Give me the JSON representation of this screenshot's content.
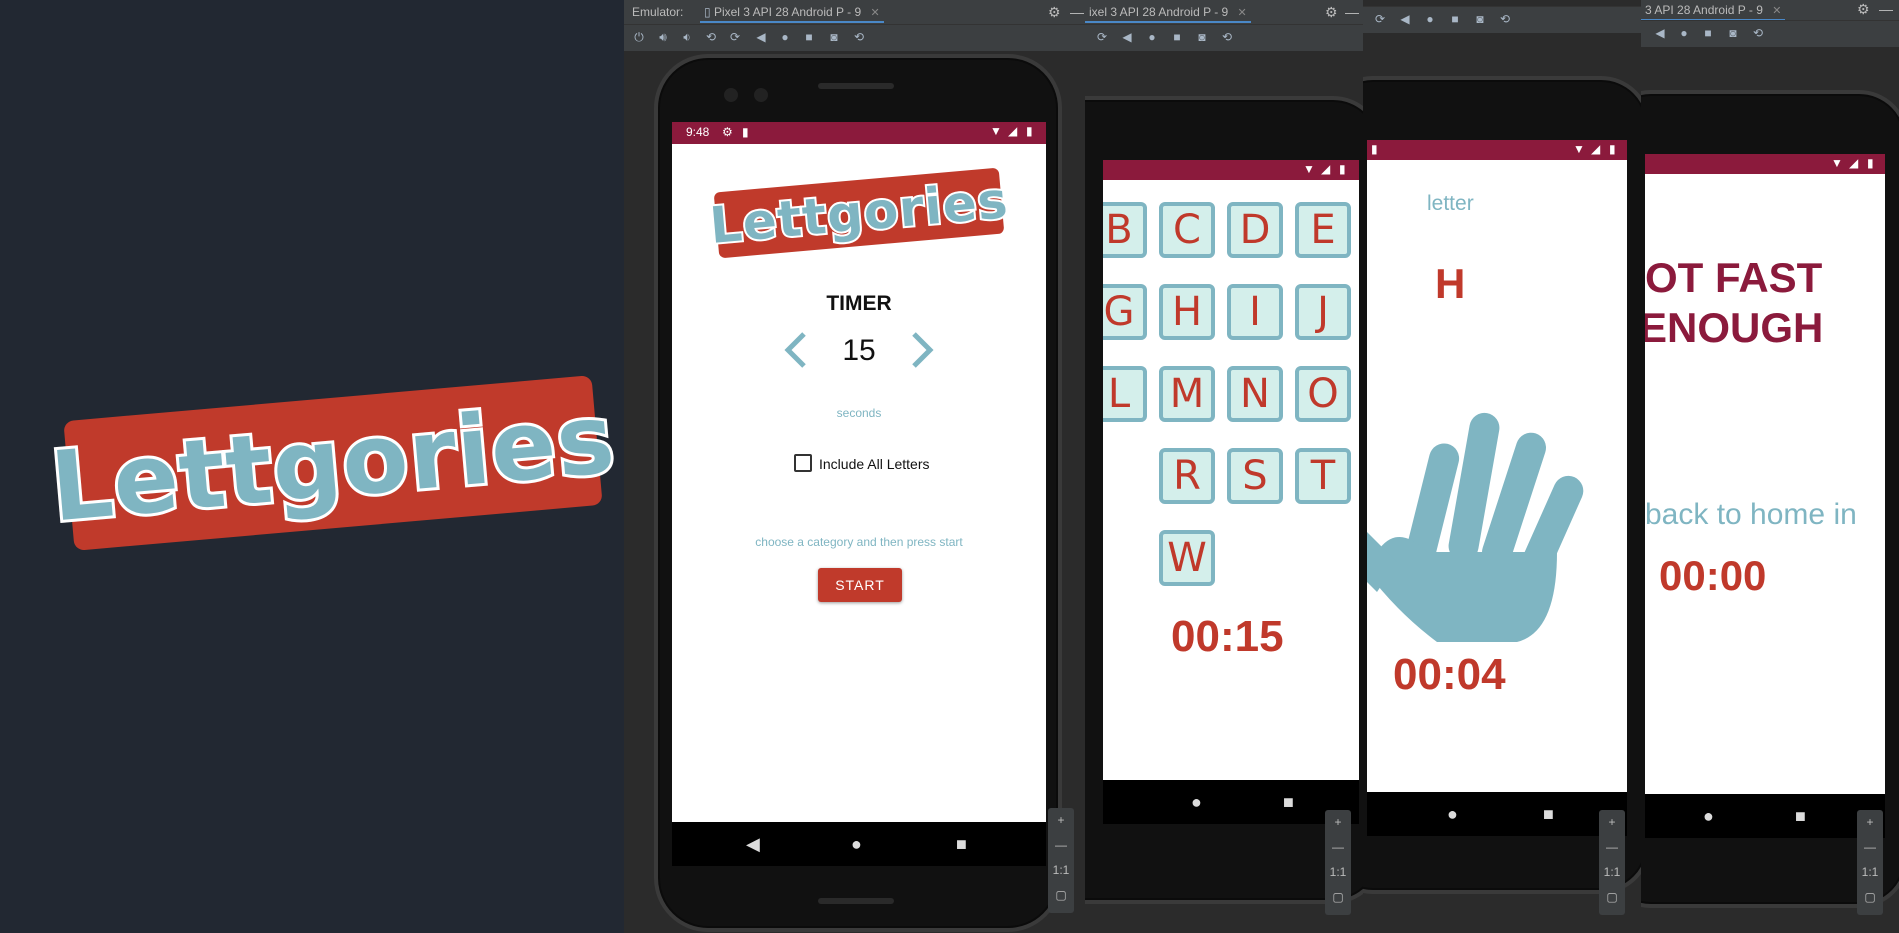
{
  "logo_text": "Lettgories",
  "colors": {
    "background": "#222832",
    "accent_red": "#c03a2b",
    "teal": "#7fb5c2",
    "status_bar": "#8b1a3c",
    "tile_fill": "#d4efeb"
  },
  "panel1": {
    "emulator_label": "Emulator:",
    "tab_label": "Pixel 3 API 28 Android P - 9",
    "status_time": "9:48",
    "logo_text": "Lettgories",
    "timer_title": "TIMER",
    "timer_value": "15",
    "timer_unit": "seconds",
    "checkbox_label": "Include All Letters",
    "hint": "choose a category and then press start",
    "start_label": "START"
  },
  "panel2": {
    "tab_label": "ixel 3 API 28 Android P - 9",
    "letters": [
      "B",
      "C",
      "D",
      "E",
      "G",
      "H",
      "I",
      "J",
      "L",
      "M",
      "N",
      "O",
      "R",
      "S",
      "T",
      "W"
    ],
    "timer": "00:15"
  },
  "panel3": {
    "label": "letter",
    "letter": "H",
    "timer": "00:04"
  },
  "panel4": {
    "tab_label": "3 API 28 Android P - 9",
    "message_line1": "OT FAST",
    "message_line2": "ENOUGH",
    "back_text": "back to home in",
    "timer": "00:00"
  },
  "zoom_controls": {
    "plus": "+",
    "minus": "—",
    "ratio": "1:1"
  }
}
